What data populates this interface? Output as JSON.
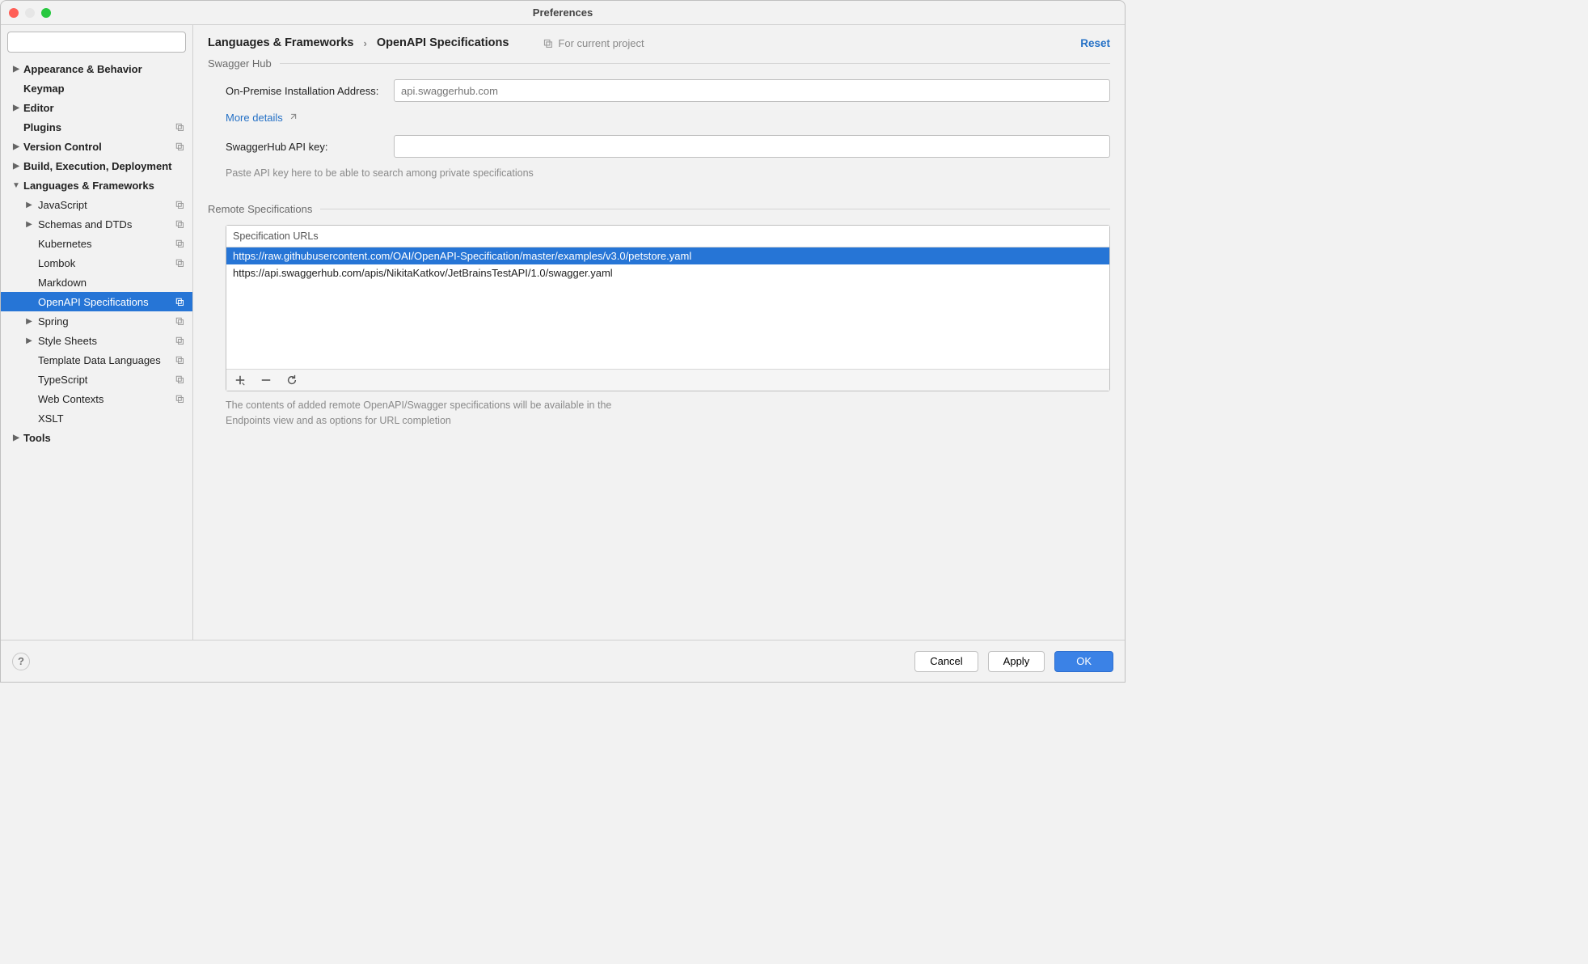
{
  "window": {
    "title": "Preferences"
  },
  "sidebar": {
    "search_placeholder": "",
    "items": [
      {
        "label": "Appearance & Behavior",
        "bold": true,
        "chev": "right"
      },
      {
        "label": "Keymap",
        "bold": true
      },
      {
        "label": "Editor",
        "bold": true,
        "chev": "right"
      },
      {
        "label": "Plugins",
        "bold": true,
        "copy": true
      },
      {
        "label": "Version Control",
        "bold": true,
        "chev": "right",
        "copy": true
      },
      {
        "label": "Build, Execution, Deployment",
        "bold": true,
        "chev": "right"
      },
      {
        "label": "Languages & Frameworks",
        "bold": true,
        "chev": "down"
      },
      {
        "label": "JavaScript",
        "indent": 1,
        "chev": "right",
        "copy": true
      },
      {
        "label": "Schemas and DTDs",
        "indent": 1,
        "chev": "right",
        "copy": true
      },
      {
        "label": "Kubernetes",
        "indent": 1,
        "copy": true
      },
      {
        "label": "Lombok",
        "indent": 1,
        "copy": true
      },
      {
        "label": "Markdown",
        "indent": 1
      },
      {
        "label": "OpenAPI Specifications",
        "indent": 1,
        "selected": true,
        "copy": true
      },
      {
        "label": "Spring",
        "indent": 1,
        "chev": "right",
        "copy": true
      },
      {
        "label": "Style Sheets",
        "indent": 1,
        "chev": "right",
        "copy": true
      },
      {
        "label": "Template Data Languages",
        "indent": 1,
        "copy": true
      },
      {
        "label": "TypeScript",
        "indent": 1,
        "copy": true
      },
      {
        "label": "Web Contexts",
        "indent": 1,
        "copy": true
      },
      {
        "label": "XSLT",
        "indent": 1
      },
      {
        "label": "Tools",
        "bold": true,
        "chev": "right"
      }
    ]
  },
  "header": {
    "crumb1": "Languages & Frameworks",
    "crumb2": "OpenAPI Specifications",
    "scope": "For current project",
    "reset": "Reset"
  },
  "swaggerhub": {
    "section": "Swagger Hub",
    "address_label": "On-Premise Installation Address:",
    "address_placeholder": "api.swaggerhub.com",
    "more_details": "More details",
    "apikey_label": "SwaggerHub API key:",
    "apikey_hint": "Paste API key here to be able to search among private specifications"
  },
  "remote": {
    "section": "Remote Specifications",
    "header": "Specification URLs",
    "rows": [
      {
        "url": "https://raw.githubusercontent.com/OAI/OpenAPI-Specification/master/examples/v3.0/petstore.yaml",
        "selected": true
      },
      {
        "url": "https://api.swaggerhub.com/apis/NikitaKatkov/JetBrainsTestAPI/1.0/swagger.yaml",
        "selected": false
      }
    ],
    "desc": "The contents of added remote OpenAPI/Swagger specifications will be available in the Endpoints view and as options for URL completion"
  },
  "footer": {
    "cancel": "Cancel",
    "apply": "Apply",
    "ok": "OK"
  }
}
